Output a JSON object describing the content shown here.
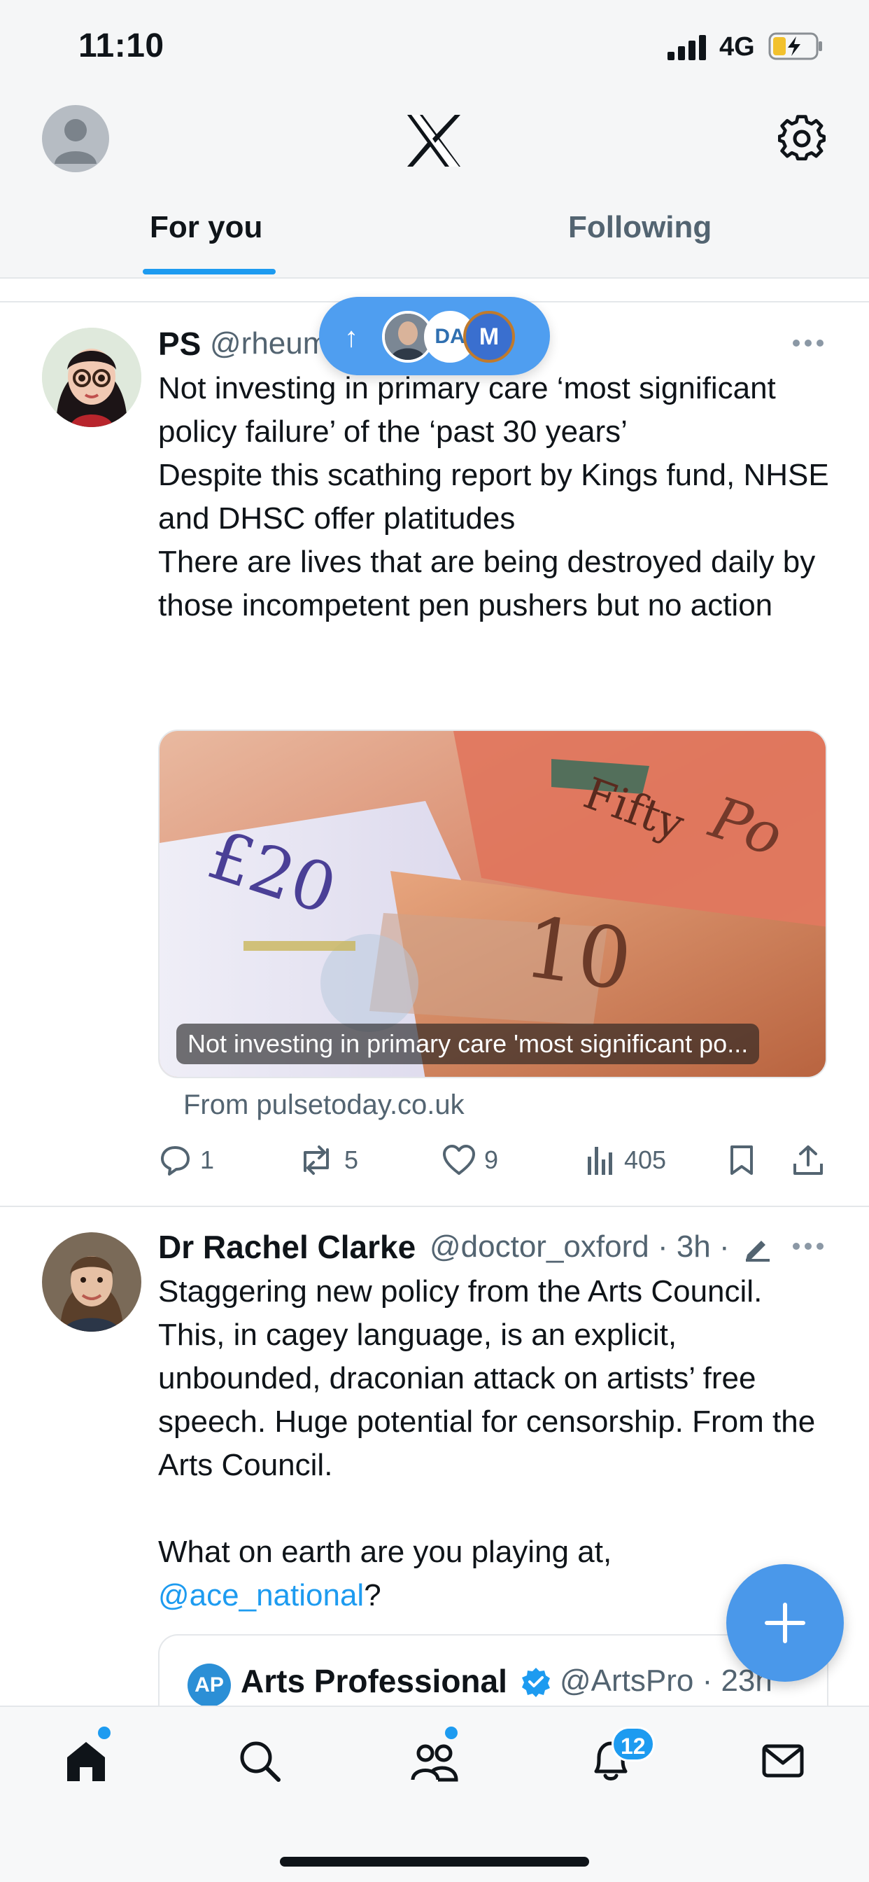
{
  "status_bar": {
    "time": "11:10",
    "network": "4G"
  },
  "header": {
    "tabs": [
      {
        "label": "For you",
        "active": true
      },
      {
        "label": "Following",
        "active": false
      }
    ]
  },
  "new_posts_pill": {
    "arrow": "↑",
    "avatars": [
      "photo",
      "DA",
      "M"
    ]
  },
  "tweets": [
    {
      "name": "PS",
      "handle": "@rheum",
      "text": "Not investing in primary care ‘most significant policy failure’ of the ‘past 30 years’\nDespite this scathing report by Kings fund, NHSE and DHSC offer platitudes\nThere are lives that are being destroyed daily by those incompetent pen pushers but no action",
      "card": {
        "caption": "Not investing in primary care 'most significant po...",
        "source": "From pulsetoday.co.uk"
      },
      "actions": {
        "replies": "1",
        "reposts": "5",
        "likes": "9",
        "views": "405"
      }
    },
    {
      "name": "Dr Rachel Clarke",
      "handle": "@doctor_oxford · 3h ·",
      "text_main": "Staggering new policy from the Arts Council. This, in cagey language, is an explicit, unbounded, draconian attack on artists’ free speech. Huge potential for censorship. From the Arts Council.\n\nWhat on earth are you playing at,",
      "mention": "@ace_national",
      "text_end": "?",
      "quote": {
        "avatar": "AP",
        "name": "Arts Professional",
        "handle": "@ArtsPro · 23h"
      }
    }
  ],
  "fab": {
    "icon": "plus-icon"
  },
  "bottom_nav": {
    "items": [
      "home-icon",
      "search-icon",
      "communities-icon",
      "notifications-icon",
      "messages-icon"
    ],
    "notification_count": "12"
  },
  "colors": {
    "accent": "#1d9bf0",
    "text": "#0f1419",
    "secondary": "#536471"
  }
}
